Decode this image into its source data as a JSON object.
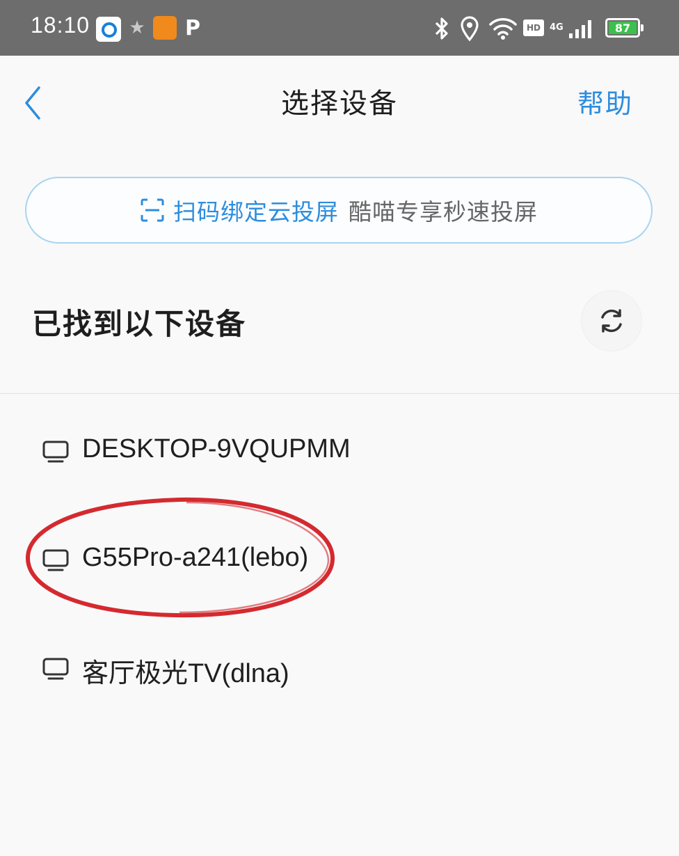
{
  "status_bar": {
    "time": "18:10",
    "hd_label": "HD",
    "network_label": "4G",
    "battery_level": "87",
    "accent_color": "#3cc04c"
  },
  "nav": {
    "title": "选择设备",
    "help_label": "帮助"
  },
  "scan_banner": {
    "primary_text": "扫码绑定云投屏",
    "secondary_text": "酷喵专享秒速投屏"
  },
  "section": {
    "title": "已找到以下设备"
  },
  "devices": [
    {
      "name": "DESKTOP-9VQUPMM",
      "icon": "monitor-icon"
    },
    {
      "name": "G55Pro-a241(lebo)",
      "icon": "monitor-icon"
    },
    {
      "name": "客厅极光TV(dlna)",
      "icon": "monitor-icon"
    }
  ],
  "colors": {
    "link_blue": "#2d8ddd",
    "annotation_red": "#d42a2f"
  }
}
